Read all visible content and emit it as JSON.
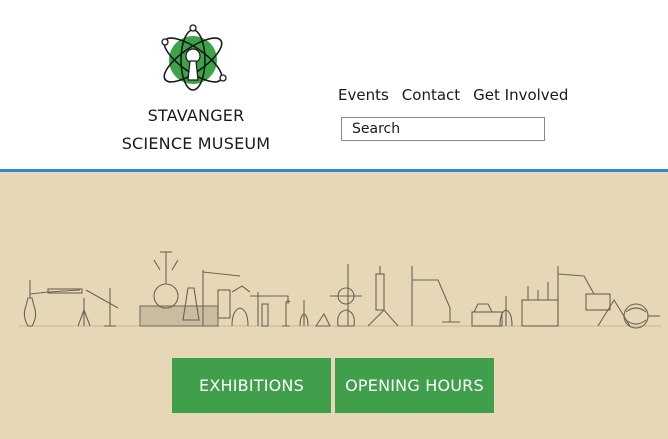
{
  "header": {
    "brand_line1": "STAVANGER",
    "brand_line2": "SCIENCE MUSEUM",
    "logo_icon": "atom-keyhole-icon"
  },
  "nav": {
    "items": [
      {
        "label": "Events"
      },
      {
        "label": "Contact"
      },
      {
        "label": "Get Involved"
      }
    ]
  },
  "search": {
    "placeholder": "Search"
  },
  "hero": {
    "illustration": "lab-apparatus-illustration",
    "buttons": {
      "exhibitions": "EXHIBITIONS",
      "opening_hours": "OPENING HOURS"
    }
  },
  "colors": {
    "accent_blue": "#2f86d4",
    "button_green": "#3f9f4a",
    "hero_background": "#e6d8b7",
    "logo_green": "#3ca34a"
  }
}
